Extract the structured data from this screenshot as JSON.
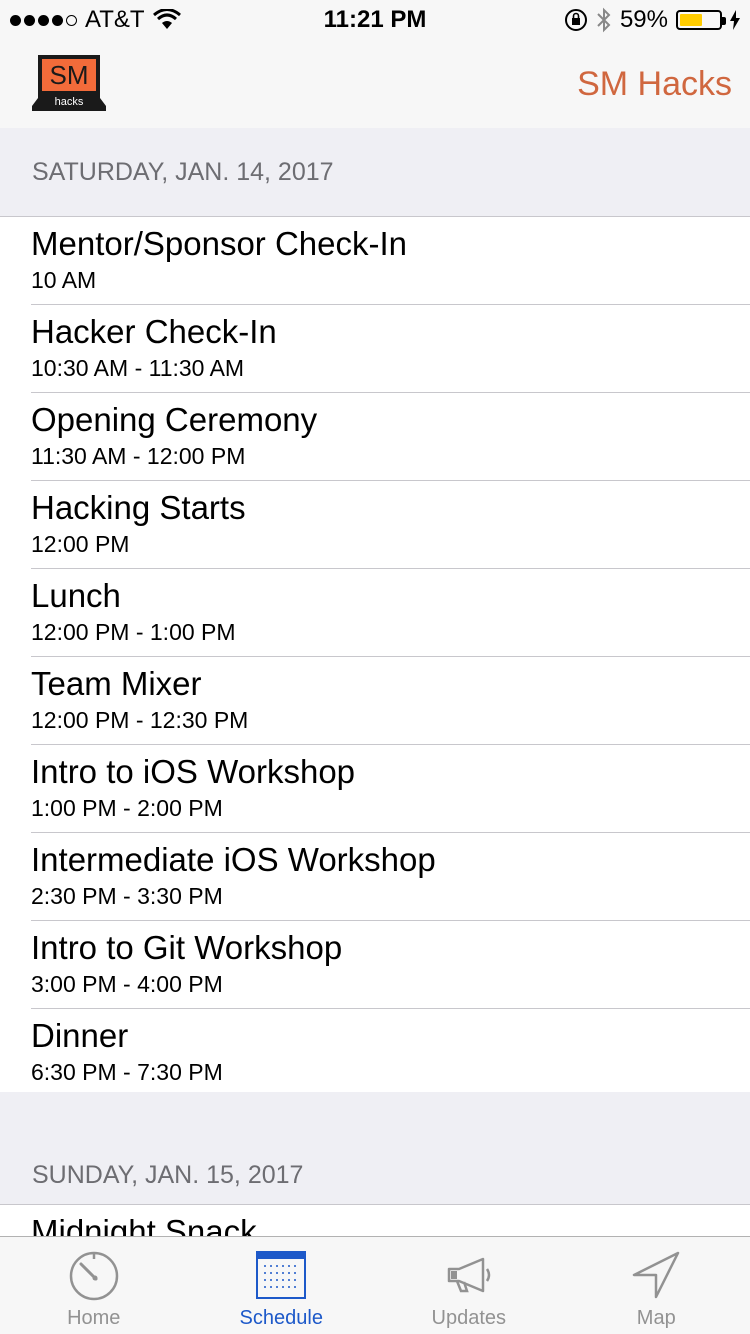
{
  "status_bar": {
    "carrier": "AT&T",
    "time": "11:21 PM",
    "battery_percent": "59%",
    "battery_level": 0.59,
    "signal_bars_filled": 4,
    "signal_bars_total": 5
  },
  "nav": {
    "logo_text_top": "SM",
    "logo_text_bottom": "hacks",
    "title": "SM Hacks",
    "accent_color": "#d0673f"
  },
  "schedule": {
    "day1": {
      "header": "SATURDAY, JAN. 14, 2017",
      "events": [
        {
          "title": "Mentor/Sponsor Check-In",
          "time": "10 AM"
        },
        {
          "title": "Hacker Check-In",
          "time": "10:30 AM - 11:30 AM"
        },
        {
          "title": "Opening Ceremony",
          "time": "11:30 AM - 12:00 PM"
        },
        {
          "title": "Hacking Starts",
          "time": "12:00 PM"
        },
        {
          "title": "Lunch",
          "time": "12:00 PM - 1:00 PM"
        },
        {
          "title": "Team Mixer",
          "time": "12:00 PM - 12:30 PM"
        },
        {
          "title": "Intro to iOS Workshop",
          "time": "1:00 PM - 2:00 PM"
        },
        {
          "title": "Intermediate iOS Workshop",
          "time": "2:30 PM - 3:30 PM"
        },
        {
          "title": "Intro to Git Workshop",
          "time": "3:00 PM - 4:00 PM"
        },
        {
          "title": "Dinner",
          "time": "6:30 PM - 7:30 PM"
        }
      ]
    },
    "day2": {
      "header": "SUNDAY, JAN. 15, 2017",
      "events": [
        {
          "title": "Midnight Snack",
          "time": ""
        }
      ]
    }
  },
  "tabs": [
    {
      "label": "Home",
      "icon": "stopwatch-icon",
      "active": false
    },
    {
      "label": "Schedule",
      "icon": "calendar-icon",
      "active": true
    },
    {
      "label": "Updates",
      "icon": "megaphone-icon",
      "active": false
    },
    {
      "label": "Map",
      "icon": "location-arrow-icon",
      "active": false
    }
  ],
  "colors": {
    "tab_active": "#1d59c9",
    "tab_inactive": "#929292",
    "battery": "#ffcc00"
  }
}
